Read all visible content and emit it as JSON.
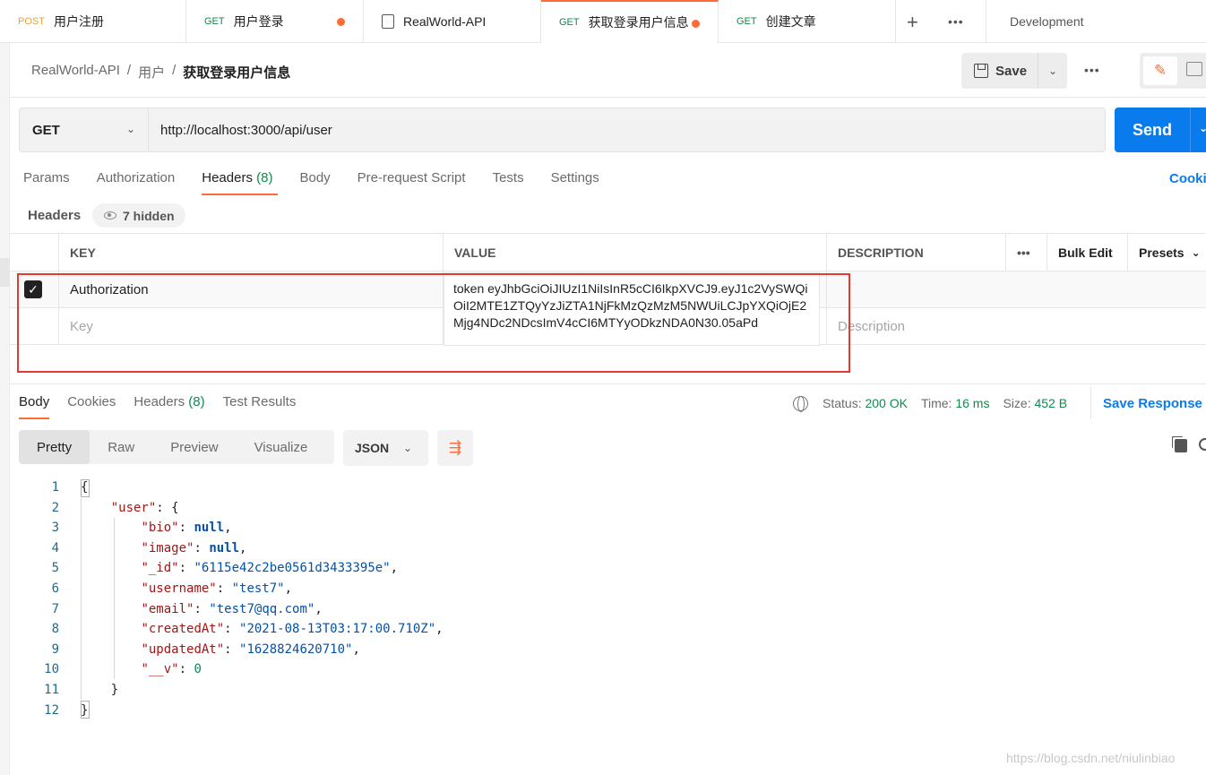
{
  "tabs": [
    {
      "method": "POST",
      "label": "用户注册",
      "unsaved": false
    },
    {
      "method": "GET",
      "label": "用户登录",
      "unsaved": true
    },
    {
      "method": "",
      "label": "RealWorld-API",
      "unsaved": false
    },
    {
      "method": "GET",
      "label": "获取登录用户信息",
      "unsaved": true,
      "active": true
    },
    {
      "method": "GET",
      "label": "创建文章",
      "unsaved": false
    }
  ],
  "tab_plus": "+",
  "tab_more": "•••",
  "environment": "Development",
  "breadcrumb": {
    "collection": "RealWorld-API",
    "sep1": "/",
    "folder": "用户",
    "sep2": "/",
    "request": "获取登录用户信息"
  },
  "toolbar": {
    "save_label": "Save",
    "chevron": "⌄",
    "more": "•••",
    "edit_icon": "✎"
  },
  "request": {
    "method": "GET",
    "url": "http://localhost:3000/api/user",
    "send_label": "Send"
  },
  "request_tabs": [
    {
      "label": "Params",
      "count": ""
    },
    {
      "label": "Authorization",
      "count": ""
    },
    {
      "label": "Headers",
      "count": "(8)",
      "active": true
    },
    {
      "label": "Body",
      "count": ""
    },
    {
      "label": "Pre-request Script",
      "count": ""
    },
    {
      "label": "Tests",
      "count": ""
    },
    {
      "label": "Settings",
      "count": ""
    }
  ],
  "cookies_link": "Cooki",
  "headers_section": {
    "title": "Headers",
    "hidden_label": "7 hidden"
  },
  "headers_table": {
    "columns": {
      "key": "KEY",
      "value": "VALUE",
      "description": "DESCRIPTION",
      "more": "•••",
      "bulk_edit": "Bulk Edit",
      "presets": "Presets"
    },
    "rows": [
      {
        "checked": true,
        "key": "Authorization",
        "value": "token eyJhbGciOiJIUzI1NiIsInR5cCI6IkpXVCJ9.eyJ1c2VySWQiOiI2MTE1ZTQyYzJiZTA1NjFkMzQzMzM5NWUiLCJpYXQiOjE2Mjg4NDc2NDcsImV4cCI6MTYyODkzNDA0N30.05aPd",
        "description": ""
      }
    ],
    "new_row": {
      "key_placeholder": "Key",
      "value_placeholder": "",
      "description_placeholder": "Description"
    }
  },
  "response_tabs": [
    {
      "label": "Body",
      "count": "",
      "active": true
    },
    {
      "label": "Cookies",
      "count": ""
    },
    {
      "label": "Headers",
      "count": "(8)"
    },
    {
      "label": "Test Results",
      "count": ""
    }
  ],
  "response_status": {
    "status_label": "Status:",
    "status_value": "200 OK",
    "time_label": "Time:",
    "time_value": "16 ms",
    "size_label": "Size:",
    "size_value": "452 B"
  },
  "save_response": "Save Response",
  "format": {
    "options": [
      "Pretty",
      "Raw",
      "Preview",
      "Visualize"
    ],
    "active": "Pretty",
    "language": "JSON",
    "wrap_icon": "⇶"
  },
  "response_body": {
    "line_numbers": [
      "1",
      "2",
      "3",
      "4",
      "5",
      "6",
      "7",
      "8",
      "9",
      "10",
      "11",
      "12"
    ],
    "user_key": "\"user\"",
    "fields": [
      {
        "key": "\"bio\"",
        "value": "null",
        "kind": "null"
      },
      {
        "key": "\"image\"",
        "value": "null",
        "kind": "null"
      },
      {
        "key": "\"_id\"",
        "value": "\"6115e42c2be0561d3433395e\"",
        "kind": "string"
      },
      {
        "key": "\"username\"",
        "value": "\"test7\"",
        "kind": "string"
      },
      {
        "key": "\"email\"",
        "value": "\"test7@qq.com\"",
        "kind": "string"
      },
      {
        "key": "\"createdAt\"",
        "value": "\"2021-08-13T03:17:00.710Z\"",
        "kind": "string"
      },
      {
        "key": "\"updatedAt\"",
        "value": "\"1628824620710\"",
        "kind": "string"
      },
      {
        "key": "\"__v\"",
        "value": "0",
        "kind": "number"
      }
    ]
  },
  "watermark": "https://blog.csdn.net/niulinbiao"
}
